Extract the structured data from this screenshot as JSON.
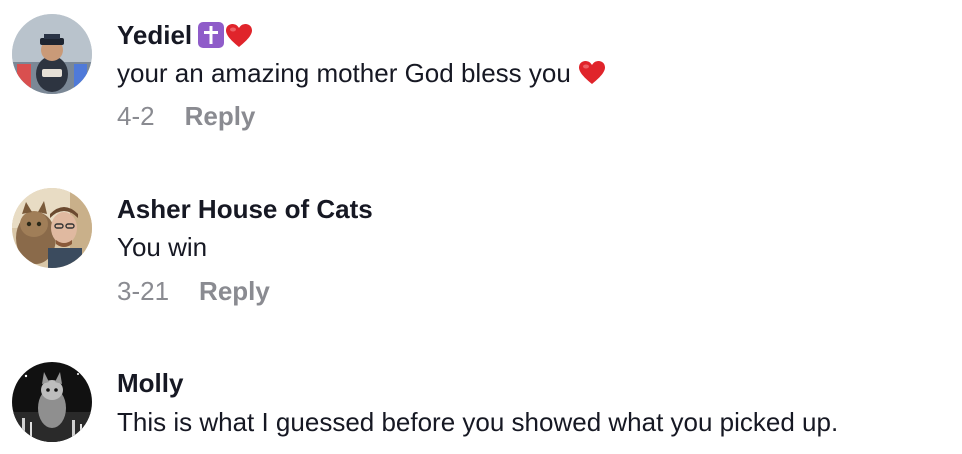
{
  "comments": [
    {
      "username": "Yediel",
      "badges": [
        "latin-cross-icon",
        "red-heart-icon"
      ],
      "text": "your an amazing mother God bless you",
      "text_emoji": "red-heart-icon",
      "date": "4-2",
      "reply_label": "Reply"
    },
    {
      "username": "Asher House of Cats",
      "text": "You win",
      "date": "3-21",
      "reply_label": "Reply"
    },
    {
      "username": "Molly",
      "text": "This is what I guessed before you showed what you picked up."
    }
  ],
  "colors": {
    "text": "#161823",
    "meta": "#8a8b91",
    "cross_badge": "#8f5cc9",
    "heart": "#e0242b"
  }
}
